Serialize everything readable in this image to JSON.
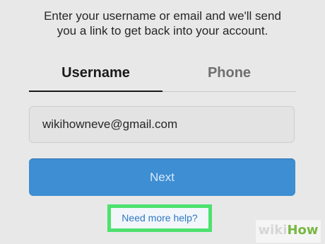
{
  "instruction": "Enter your username or email and we'll send you a link to get back into your account.",
  "tabs": {
    "username": "Username",
    "phone": "Phone"
  },
  "input": {
    "value": "wikihowneve@gmail.com"
  },
  "actions": {
    "next": "Next",
    "help": "Need more help?"
  },
  "watermark": {
    "wiki": "wiki",
    "how": "How"
  },
  "colors": {
    "accent": "#3d8ed3",
    "highlight": "#4de16f",
    "link": "#2f78c2"
  }
}
